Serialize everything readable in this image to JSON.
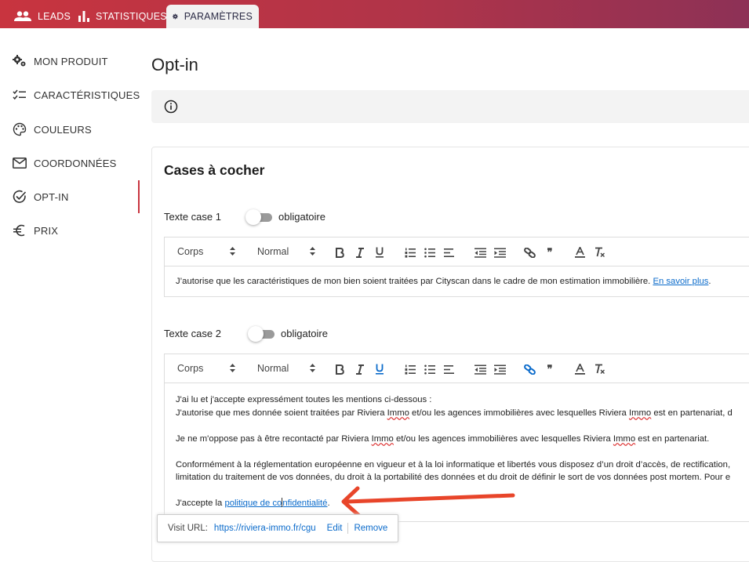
{
  "topnav": {
    "tabs": [
      {
        "label": "LEADS",
        "icon": "people-icon"
      },
      {
        "label": "STATISTIQUES",
        "icon": "bar-chart-icon"
      },
      {
        "label": "PARAMÈTRES",
        "icon": "gear-icon",
        "active": true
      }
    ]
  },
  "sidebar": {
    "items": [
      {
        "label": "MON PRODUIT",
        "icon": "gears-icon"
      },
      {
        "label": "CARACTÉRISTIQUES",
        "icon": "checklist-icon"
      },
      {
        "label": "COULEURS",
        "icon": "palette-icon"
      },
      {
        "label": "COORDONNÉES",
        "icon": "envelope-icon"
      },
      {
        "label": "OPT-IN",
        "icon": "check-circle-icon",
        "active": true
      },
      {
        "label": "PRIX",
        "icon": "euro-icon"
      }
    ]
  },
  "page": {
    "title": "Opt-in"
  },
  "card": {
    "title": "Cases à cocher"
  },
  "case1": {
    "label": "Texte case 1",
    "toggle_label": "obligatoire",
    "toggle_on": false,
    "toolbar": {
      "font": "Corps",
      "size": "Normal"
    },
    "text": "J’autorise que les caractéristiques de mon bien soient traitées par Cityscan dans le cadre de mon estimation immobilière. ",
    "link": "En savoir plus",
    "after_link": "."
  },
  "case2": {
    "label": "Texte case 2",
    "toggle_label": "obligatoire",
    "toggle_on": false,
    "toolbar": {
      "font": "Corps",
      "size": "Normal"
    },
    "line1": "J'ai lu et j'accepte expressément toutes les mentions ci-dessous :",
    "line2a": "J'autorise que mes donnée soient traitées par Riviera ",
    "immo": "Immo",
    "line2b": " et/ou les agences immobilières avec lesquelles Riviera ",
    "line2c": " est en partenariat, d",
    "line3a": "Je ne m'oppose pas à être recontacté par Riviera ",
    "line3b": " et/ou les agences immobilières avec lesquelles Riviera ",
    "line3c": " est en partenariat.",
    "line4": "Conformément à la réglementation européenne en vigueur et à la loi informatique et libertés vous disposez d’un droit d’accès, de rectification,",
    "line5": "limitation du traitement de vos données, du droit à la portabilité des données et du droit de définir le sort de vos données post mortem. Pour e",
    "line6a": "J'accepte la ",
    "link_a": "politique de co",
    "link_b": "nfidentialité",
    "line6b": "."
  },
  "tooltip": {
    "label": "Visit URL:",
    "url": "https://riviera-immo.fr/cgu",
    "edit": "Edit",
    "remove": "Remove"
  },
  "colors": {
    "accent": "#c8343f",
    "link": "#0b6bcb",
    "arrow": "#e8452a"
  }
}
